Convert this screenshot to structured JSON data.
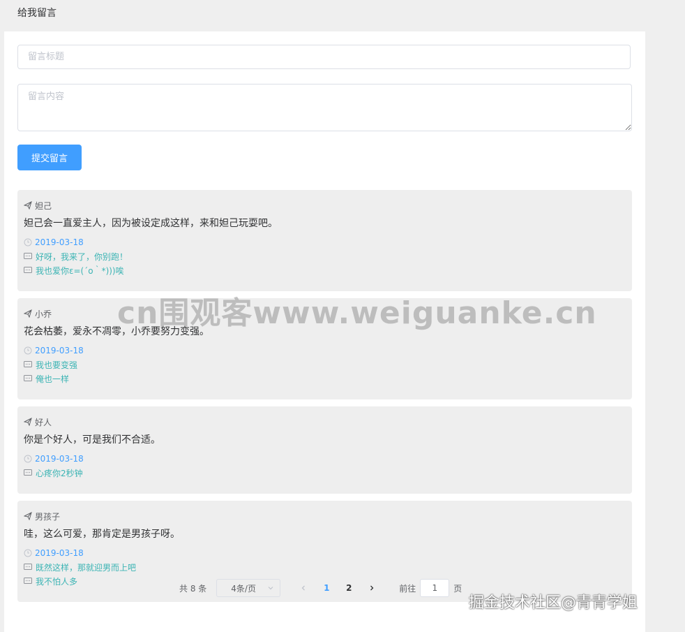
{
  "header": {
    "title": "给我留言"
  },
  "form": {
    "title_placeholder": "留言标题",
    "content_placeholder": "留言内容",
    "submit_label": "提交留言"
  },
  "messages": [
    {
      "author": "妲己",
      "text": "妲己会一直爱主人，因为被设定成这样，来和妲己玩耍吧。",
      "date": "2019-03-18",
      "replies": [
        "好呀，我来了，你别跑！",
        "我也爱你ε=(´ο｀*)))唉"
      ]
    },
    {
      "author": "小乔",
      "text": "花会枯萎，爱永不凋零，小乔要努力变强。",
      "date": "2019-03-18",
      "replies": [
        "我也要变强",
        "俺也一样"
      ]
    },
    {
      "author": "好人",
      "text": "你是个好人，可是我们不合适。",
      "date": "2019-03-18",
      "replies": [
        "心疼你2秒钟"
      ]
    },
    {
      "author": "男孩子",
      "text": "哇，这么可爱，那肯定是男孩子呀。",
      "date": "2019-03-18",
      "replies": [
        "既然这样，那就迎男而上吧",
        "我不怕人多"
      ]
    }
  ],
  "pagination": {
    "total": "共 8 条",
    "page_size": "4条/页",
    "pages": [
      "1",
      "2"
    ],
    "current": "1",
    "goto_label": "前往",
    "goto_value": "1",
    "page_suffix": "页"
  },
  "watermarks": {
    "center": "cn围观客www.weiguanke.cn",
    "corner": "掘金技术社区@青青学姐"
  },
  "colors": {
    "primary": "#409eff",
    "reply": "#3cb4b4",
    "card_bg": "#eeeeee"
  }
}
